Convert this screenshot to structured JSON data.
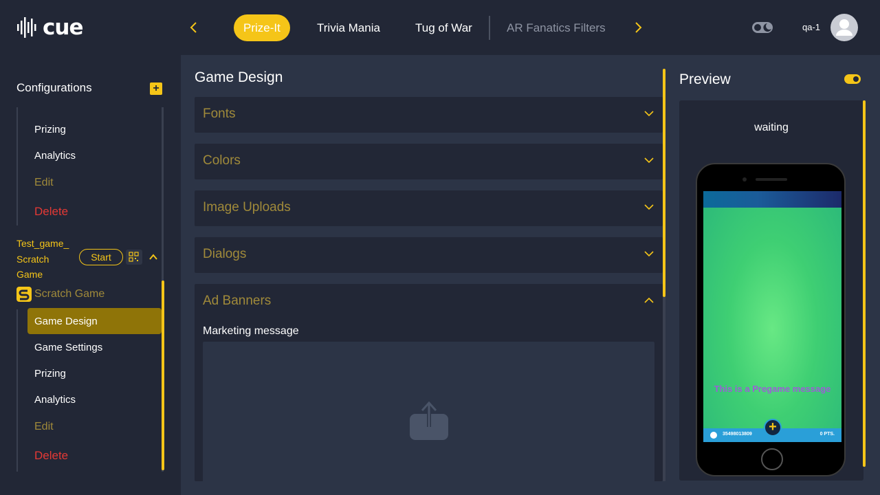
{
  "app": {
    "logo_text": "cue"
  },
  "header": {
    "tabs": [
      {
        "label": "Prize-It",
        "active": true
      },
      {
        "label": "Trivia Mania",
        "active": false
      },
      {
        "label": "Tug of War",
        "active": false
      },
      {
        "label": "AR Fanatics Filters",
        "active": false
      }
    ],
    "user_name": "qa-1"
  },
  "sidebar": {
    "title": "Configurations",
    "first_game_items": [
      {
        "label": "Prizing"
      },
      {
        "label": "Analytics"
      },
      {
        "label": "Edit"
      },
      {
        "label": "Delete"
      }
    ],
    "game": {
      "name_line1": "Test_game_",
      "name_line2": "Scratch",
      "name_line3": "Game",
      "start_label": "Start",
      "type_label": "Scratch Game",
      "items": [
        {
          "label": "Game Design",
          "active": true
        },
        {
          "label": "Game Settings"
        },
        {
          "label": "Prizing"
        },
        {
          "label": "Analytics"
        },
        {
          "label": "Edit"
        },
        {
          "label": "Delete"
        }
      ]
    }
  },
  "main": {
    "title": "Game Design",
    "accordions": [
      {
        "label": "Fonts",
        "expanded": false
      },
      {
        "label": "Colors",
        "expanded": false
      },
      {
        "label": "Image Uploads",
        "expanded": false
      },
      {
        "label": "Dialogs",
        "expanded": false
      },
      {
        "label": "Ad Banners",
        "expanded": true
      }
    ],
    "ad_banners": {
      "marketing_label": "Marketing message"
    }
  },
  "preview": {
    "title": "Preview",
    "status": "waiting",
    "pregame_message": "This is a Pregame message",
    "footer_id": "3549801380​9",
    "footer_points": "0 PTS."
  },
  "colors": {
    "accent": "#f5c518",
    "background": "#222736",
    "panel": "#2c3446",
    "delete": "#e53935"
  }
}
